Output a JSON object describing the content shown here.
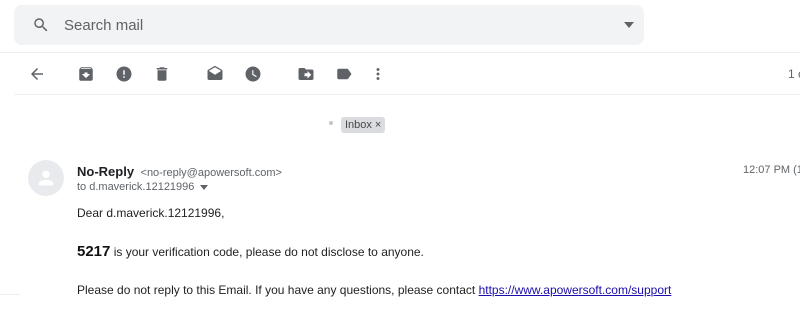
{
  "search": {
    "placeholder": "Search mail",
    "value": ""
  },
  "toolbar": {
    "page_count": "1 o"
  },
  "labels": [
    {
      "name": "Inbox",
      "remove_glyph": "×"
    }
  ],
  "email": {
    "sender_name": "No-Reply",
    "sender_email": "<no-reply@apowersoft.com>",
    "recipient": "to d.maverick.12121996",
    "timestamp": "12:07 PM (1",
    "greeting": "Dear d.maverick.12121996,",
    "code": "5217",
    "code_message": " is your verification code, please do not disclose to anyone.",
    "disclaimer": "Please do not reply to this Email. If you have any questions, please contact ",
    "support_link": "https://www.apowersoft.com/support"
  },
  "colors": {
    "search_bg": "#f1f3f4",
    "label_chip_bg": "#dadce0",
    "link": "#1a0dab",
    "icon": "#5f6368"
  }
}
